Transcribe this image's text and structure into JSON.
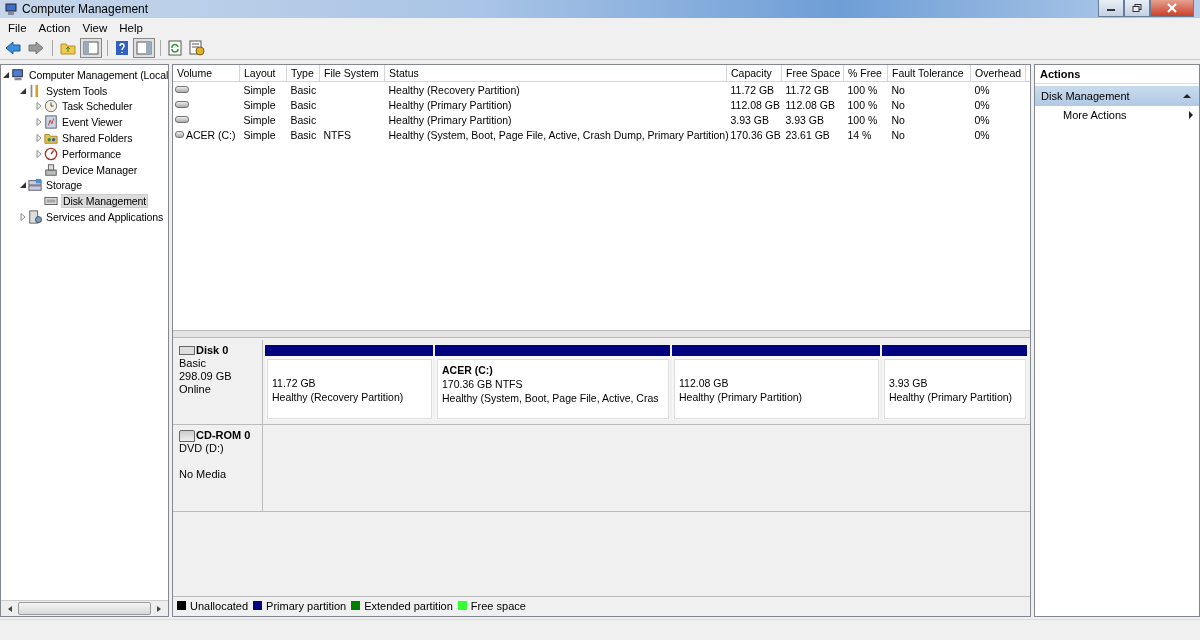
{
  "window": {
    "title": "Computer Management"
  },
  "menu": [
    "File",
    "Action",
    "View",
    "Help"
  ],
  "tree": [
    {
      "label": "Computer Management (Local",
      "kind": "computer",
      "expanded": true,
      "selected": false,
      "children": [
        {
          "label": "System Tools",
          "kind": "tools",
          "expanded": true,
          "selected": false,
          "children": [
            {
              "label": "Task Scheduler",
              "kind": "clock",
              "expanded": false,
              "selected": false
            },
            {
              "label": "Event Viewer",
              "kind": "log",
              "expanded": false,
              "selected": false
            },
            {
              "label": "Shared Folders",
              "kind": "share",
              "expanded": false,
              "selected": false
            },
            {
              "label": "Performance",
              "kind": "gauge",
              "expanded": false,
              "selected": false
            },
            {
              "label": "Device Manager",
              "kind": "device",
              "selected": false
            }
          ]
        },
        {
          "label": "Storage",
          "kind": "storage",
          "expanded": true,
          "selected": false,
          "children": [
            {
              "label": "Disk Management",
              "kind": "disk",
              "selected": true
            }
          ]
        },
        {
          "label": "Services and Applications",
          "kind": "services",
          "expanded": false,
          "selected": false
        }
      ]
    }
  ],
  "volumes": {
    "columns": [
      "Volume",
      "Layout",
      "Type",
      "File System",
      "Status",
      "Capacity",
      "Free Space",
      "% Free",
      "Fault Tolerance",
      "Overhead"
    ],
    "rows": [
      [
        "",
        "Simple",
        "Basic",
        "",
        "Healthy (Recovery Partition)",
        "11.72 GB",
        "11.72 GB",
        "100 %",
        "No",
        "0%"
      ],
      [
        "",
        "Simple",
        "Basic",
        "",
        "Healthy (Primary Partition)",
        "112.08 GB",
        "112.08 GB",
        "100 %",
        "No",
        "0%"
      ],
      [
        "",
        "Simple",
        "Basic",
        "",
        "Healthy (Primary Partition)",
        "3.93 GB",
        "3.93 GB",
        "100 %",
        "No",
        "0%"
      ],
      [
        "ACER (C:)",
        "Simple",
        "Basic",
        "NTFS",
        "Healthy (System, Boot, Page File, Active, Crash Dump, Primary Partition)",
        "170.36 GB",
        "23.61 GB",
        "14 %",
        "No",
        "0%"
      ]
    ]
  },
  "disks": [
    {
      "kind": "disk",
      "name": "Disk 0",
      "type": "Basic",
      "size": "298.09 GB",
      "status": "Online",
      "partitions": [
        {
          "size": "11.72 GB",
          "status": "Healthy (Recovery Partition)"
        },
        {
          "name": "ACER  (C:)",
          "size": "170.36 GB NTFS",
          "status": "Healthy (System, Boot, Page File, Active, Cras"
        },
        {
          "size": "112.08 GB",
          "status": "Healthy (Primary Partition)"
        },
        {
          "size": "3.93 GB",
          "status": "Healthy (Primary Partition)"
        }
      ]
    },
    {
      "kind": "cdrom",
      "name": "CD-ROM 0",
      "type": "DVD (D:)",
      "status": "No Media"
    }
  ],
  "legend": [
    {
      "label": "Unallocated",
      "color": "#000000"
    },
    {
      "label": "Primary partition",
      "color": "#000080"
    },
    {
      "label": "Extended partition",
      "color": "#008000"
    },
    {
      "label": "Free space",
      "color": "#33ff33"
    }
  ],
  "actions": {
    "title": "Actions",
    "section": "Disk Management",
    "items": [
      "More Actions"
    ]
  }
}
